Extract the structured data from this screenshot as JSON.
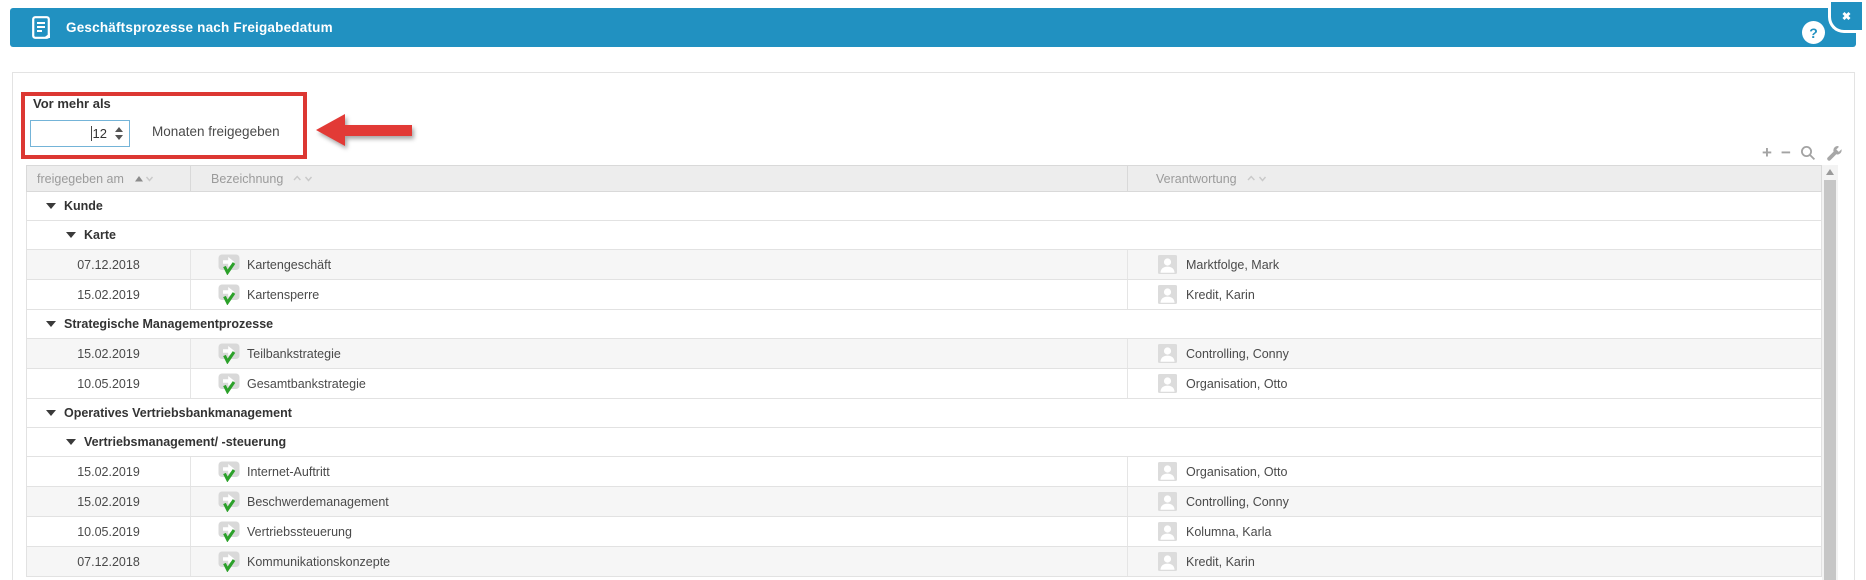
{
  "window": {
    "title": "Geschäftsprozesse nach Freigabedatum",
    "help_glyph": "?",
    "close_glyph": "✖"
  },
  "filter": {
    "label": "Vor mehr als",
    "value": "12",
    "suffix": "Monaten freigegeben"
  },
  "toolbar": {
    "plus_glyph": "+",
    "minus_glyph": "−"
  },
  "table": {
    "columns": [
      {
        "label": "freigegeben am",
        "sort": "sorted-asc"
      },
      {
        "label": "Bezeichnung",
        "sort": "unsorted"
      },
      {
        "label": "Verantwortung",
        "sort": "unsorted"
      }
    ],
    "rows": [
      {
        "type": "group",
        "level": 1,
        "label": "Kunde"
      },
      {
        "type": "group",
        "level": 2,
        "label": "Karte"
      },
      {
        "type": "data",
        "date": "07.12.2018",
        "name": "Kartengeschäft",
        "owner": "Marktfolge, Mark",
        "shaded": true
      },
      {
        "type": "data",
        "date": "15.02.2019",
        "name": "Kartensperre",
        "owner": "Kredit, Karin",
        "shaded": false
      },
      {
        "type": "group",
        "level": 1,
        "label": "Strategische Managementprozesse"
      },
      {
        "type": "data",
        "date": "15.02.2019",
        "name": "Teilbankstrategie",
        "owner": "Controlling, Conny",
        "shaded": true
      },
      {
        "type": "data",
        "date": "10.05.2019",
        "name": "Gesamtbankstrategie",
        "owner": "Organisation, Otto",
        "shaded": false
      },
      {
        "type": "group",
        "level": 1,
        "label": "Operatives Vertriebsbankmanagement"
      },
      {
        "type": "group",
        "level": 2,
        "label": "Vertriebsmanagement/ -steuerung"
      },
      {
        "type": "data",
        "date": "15.02.2019",
        "name": "Internet-Auftritt",
        "owner": "Organisation, Otto",
        "shaded": false
      },
      {
        "type": "data",
        "date": "15.02.2019",
        "name": "Beschwerdemanagement",
        "owner": "Controlling, Conny",
        "shaded": true
      },
      {
        "type": "data",
        "date": "10.05.2019",
        "name": "Vertriebssteuerung",
        "owner": "Kolumna, Karla",
        "shaded": false
      },
      {
        "type": "data",
        "date": "07.12.2018",
        "name": "Kommunikationskonzepte",
        "owner": "Kredit, Karin",
        "shaded": true
      }
    ]
  },
  "colors": {
    "accent_blue": "#2191c1",
    "annotation_red": "#e23a36",
    "check_green": "#2ca12a",
    "header_gray": "#ededed"
  }
}
